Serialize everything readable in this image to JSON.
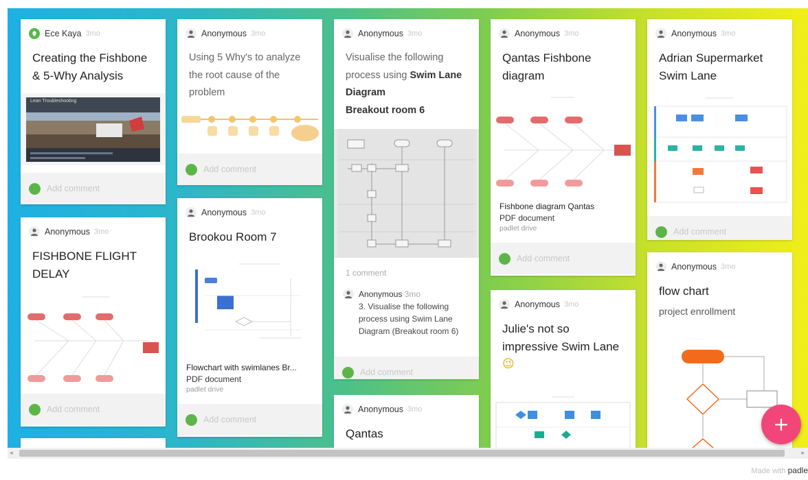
{
  "board": {
    "add_button_label": "+",
    "footer_prefix": "Made with",
    "footer_brand": "padle",
    "add_comment_label": "Add comment",
    "scroll_left": "◂",
    "scroll_right": "▸"
  },
  "cards": {
    "c1": {
      "author": "Ece Kaya",
      "time": "3mo",
      "title": "Creating the Fishbone & 5-Why Analysis",
      "thumb_banner": "Lean Troubleshooting"
    },
    "c2": {
      "author": "Anonymous",
      "time": "3mo",
      "title": "FISHBONE FLIGHT DELAY"
    },
    "c3": {
      "author": "Anonymous",
      "time": "3mo",
      "body": "Using 5 Why's to analyze the root cause of the problem"
    },
    "c4": {
      "author": "Anonymous",
      "time": "3mo",
      "title": "Brookou Room 7",
      "attachment_title": "Flowchart with swimlanes Br...",
      "attachment_type": "PDF document",
      "attachment_source": "padlet drive"
    },
    "c5": {
      "author": "Anonymous",
      "time": "3mo",
      "body_prefix": "Visualise the following process using ",
      "body_bold": "Swim Lane Diagram",
      "body_line2": "Breakout room 6",
      "comment_count": "1 comment",
      "comment_author": "Anonymous",
      "comment_time": "3mo",
      "comment_text": "3. Visualise the following process using Swim Lane Diagram (Breakout room 6)"
    },
    "c6": {
      "author": "Anonymous",
      "time": "3mo",
      "title": "Qantas"
    },
    "c7": {
      "author": "Anonymous",
      "time": "3mo",
      "title": "Qantas Fishbone diagram",
      "attachment_title": "Fishbone diagram Qantas",
      "attachment_type": "PDF document",
      "attachment_source": "padlet drive"
    },
    "c8": {
      "author": "Anonymous",
      "time": "3mo",
      "title": "Julie's not so impressive Swim Lane",
      "emoji": "😉"
    },
    "c9": {
      "author": "Anonymous",
      "time": "3mo",
      "title": "Adrian Supermarket Swim Lane"
    },
    "c10": {
      "author": "Anonymous",
      "time": "3mo",
      "title": "flow chart",
      "body": "project  enrollment"
    }
  }
}
